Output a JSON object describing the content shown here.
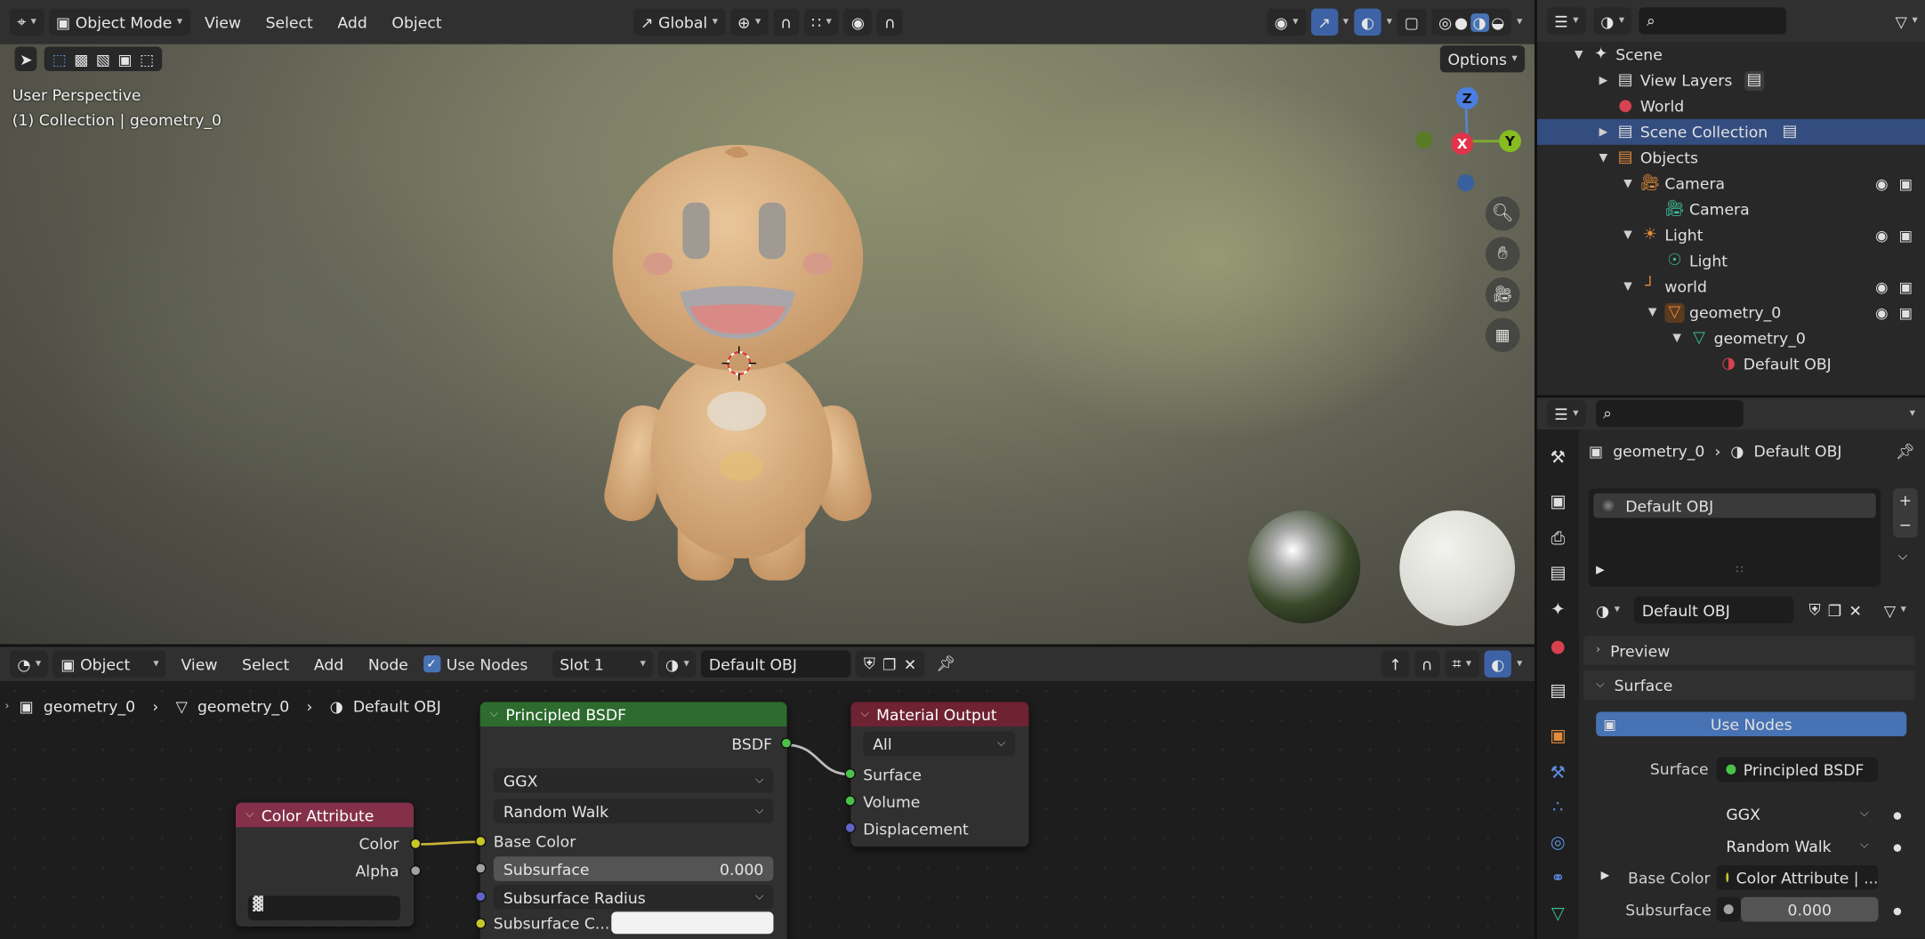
{
  "viewport": {
    "mode": "Object Mode",
    "menus": [
      "View",
      "Select",
      "Add",
      "Object"
    ],
    "transform_orientation": "Global",
    "options_label": "Options",
    "overlay_view": "User Perspective",
    "overlay_collection": "(1) Collection | geometry_0",
    "gizmo_axes": [
      "Z",
      "X",
      "Y"
    ]
  },
  "node_editor": {
    "editor_type": "Object",
    "menus": [
      "View",
      "Select",
      "Add",
      "Node"
    ],
    "use_nodes_label": "Use Nodes",
    "slot": "Slot 1",
    "material": "Default OBJ",
    "breadcrumb": [
      "geometry_0",
      "geometry_0",
      "Default OBJ"
    ],
    "principled": {
      "title": "Principled BSDF",
      "output": "BSDF",
      "distribution": "GGX",
      "subsurface_method": "Random Walk",
      "base_color": "Base Color",
      "subsurface_label": "Subsurface",
      "subsurface_value": "0.000",
      "subsurface_radius": "Subsurface Radius",
      "subsurface_color": "Subsurface C..."
    },
    "color_attribute": {
      "title": "Color Attribute",
      "out_color": "Color",
      "out_alpha": "Alpha"
    },
    "material_output": {
      "title": "Material Output",
      "target": "All",
      "inputs": [
        "Surface",
        "Volume",
        "Displacement"
      ]
    }
  },
  "outliner": {
    "rows": [
      {
        "label": "Scene"
      },
      {
        "label": "View Layers"
      },
      {
        "label": "World"
      },
      {
        "label": "Scene Collection"
      },
      {
        "label": "Objects"
      },
      {
        "label": "Camera"
      },
      {
        "label": "Camera"
      },
      {
        "label": "Light"
      },
      {
        "label": "Light"
      },
      {
        "label": "world"
      },
      {
        "label": "geometry_0"
      },
      {
        "label": "geometry_0"
      },
      {
        "label": "Default OBJ"
      }
    ]
  },
  "properties": {
    "breadcrumb_object": "geometry_0",
    "breadcrumb_material": "Default OBJ",
    "slot_item": "Default OBJ",
    "material_name": "Default OBJ",
    "preview_label": "Preview",
    "surface_label": "Surface",
    "use_nodes_button": "Use Nodes",
    "surface_field_label": "Surface",
    "surface_field_value": "Principled BSDF",
    "distribution": "GGX",
    "subsurface_method": "Random Walk",
    "base_color_label": "Base Color",
    "base_color_value": "Color Attribute | ...",
    "subsurface_label": "Subsurface",
    "subsurface_value": "0.000"
  },
  "colors": {
    "accent": "#4772b3",
    "shader_header": "#2d6b2e",
    "input_header": "#84304a",
    "output_header": "#6e2232",
    "selection": "#334d80"
  }
}
